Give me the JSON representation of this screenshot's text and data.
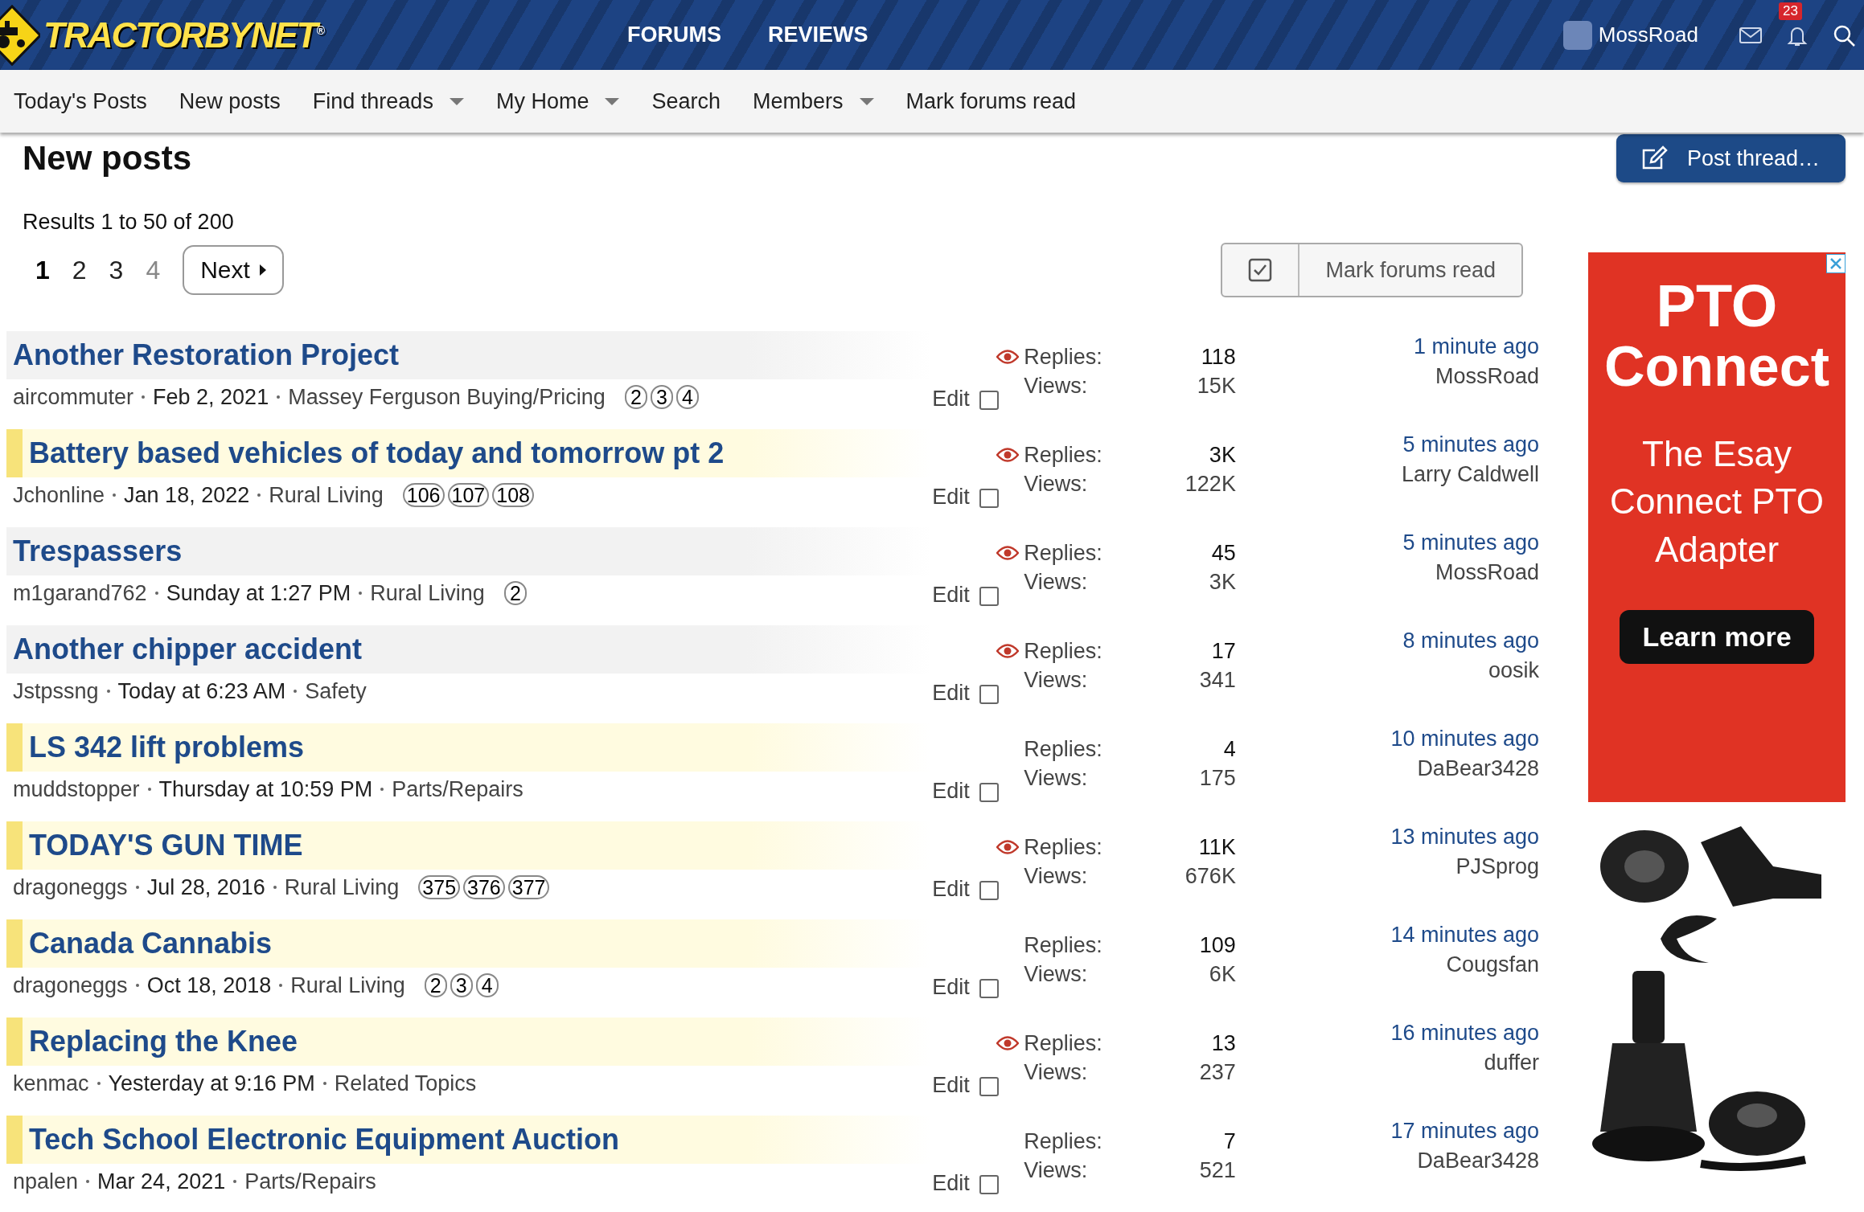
{
  "header": {
    "logo": "TRACTORBYNET",
    "logo_mark": "®",
    "nav": [
      {
        "label": "FORUMS"
      },
      {
        "label": "REVIEWS"
      }
    ],
    "user": "MossRoad",
    "alerts_badge": "23"
  },
  "subnav": [
    {
      "label": "Today's Posts",
      "has_menu": false
    },
    {
      "label": "New posts",
      "has_menu": false
    },
    {
      "label": "Find threads",
      "has_menu": true
    },
    {
      "label": "My Home",
      "has_menu": true
    },
    {
      "label": "Search",
      "has_menu": false
    },
    {
      "label": "Members",
      "has_menu": true
    },
    {
      "label": "Mark forums read",
      "has_menu": false
    }
  ],
  "page_title": "New posts",
  "post_button": "Post thread…",
  "results": "Results 1 to 50 of 200",
  "pagination": [
    {
      "label": "1",
      "selected": true,
      "muted": false
    },
    {
      "label": "2",
      "selected": false,
      "muted": false
    },
    {
      "label": "3",
      "selected": false,
      "muted": false
    },
    {
      "label": "4",
      "selected": false,
      "muted": true
    }
  ],
  "next_button": "Next",
  "mark_read_button": "Mark forums read",
  "threads": [
    {
      "title": "Another Restoration Project",
      "unread": false,
      "author": "aircommuter",
      "date": "Feb 2, 2021",
      "forum": "Massey Ferguson Buying/Pricing",
      "pages": [
        "2",
        "3",
        "4"
      ],
      "watched": true,
      "edit": "Edit",
      "checked": false,
      "replies_label": "Replies:",
      "replies": "118",
      "views_label": "Views:",
      "views": "15K",
      "last_time": "1 minute ago",
      "last_user": "MossRoad"
    },
    {
      "title": "Battery based vehicles of today and tomorrow pt 2",
      "unread": true,
      "author": "Jchonline",
      "date": "Jan 18, 2022",
      "forum": "Rural Living",
      "pages": [
        "106",
        "107",
        "108"
      ],
      "watched": true,
      "edit": "Edit",
      "checked": false,
      "replies_label": "Replies:",
      "replies": "3K",
      "views_label": "Views:",
      "views": "122K",
      "last_time": "5 minutes ago",
      "last_user": "Larry Caldwell"
    },
    {
      "title": "Trespassers",
      "unread": false,
      "author": "m1garand762",
      "date": "Sunday at 1:27 PM",
      "forum": "Rural Living",
      "pages": [
        "2"
      ],
      "watched": true,
      "edit": "Edit",
      "checked": false,
      "replies_label": "Replies:",
      "replies": "45",
      "views_label": "Views:",
      "views": "3K",
      "last_time": "5 minutes ago",
      "last_user": "MossRoad"
    },
    {
      "title": "Another chipper accident",
      "unread": false,
      "author": "Jstpssng",
      "date": "Today at 6:23 AM",
      "forum": "Safety",
      "watched": true,
      "edit": "Edit",
      "checked": false,
      "replies_label": "Replies:",
      "replies": "17",
      "views_label": "Views:",
      "views": "341",
      "last_time": "8 minutes ago",
      "last_user": "oosik"
    },
    {
      "title": "LS 342 lift problems",
      "unread": true,
      "author": "muddstopper",
      "date": "Thursday at 10:59 PM",
      "forum": "Parts/Repairs",
      "watched": false,
      "edit": "Edit",
      "checked": false,
      "replies_label": "Replies:",
      "replies": "4",
      "views_label": "Views:",
      "views": "175",
      "last_time": "10 minutes ago",
      "last_user": "DaBear3428"
    },
    {
      "title": "TODAY'S GUN TIME",
      "unread": true,
      "author": "dragoneggs",
      "date": "Jul 28, 2016",
      "forum": "Rural Living",
      "pages": [
        "375",
        "376",
        "377"
      ],
      "watched": true,
      "edit": "Edit",
      "checked": false,
      "replies_label": "Replies:",
      "replies": "11K",
      "views_label": "Views:",
      "views": "676K",
      "last_time": "13 minutes ago",
      "last_user": "PJSprog"
    },
    {
      "title": "Canada Cannabis",
      "unread": true,
      "author": "dragoneggs",
      "date": "Oct 18, 2018",
      "forum": "Rural Living",
      "pages": [
        "2",
        "3",
        "4"
      ],
      "watched": false,
      "edit": "Edit",
      "checked": false,
      "replies_label": "Replies:",
      "replies": "109",
      "views_label": "Views:",
      "views": "6K",
      "last_time": "14 minutes ago",
      "last_user": "Cougsfan"
    },
    {
      "title": "Replacing the Knee",
      "unread": true,
      "author": "kenmac",
      "date": "Yesterday at 9:16 PM",
      "forum": "Related Topics",
      "watched": true,
      "edit": "Edit",
      "checked": false,
      "replies_label": "Replies:",
      "replies": "13",
      "views_label": "Views:",
      "views": "237",
      "last_time": "16 minutes ago",
      "last_user": "duffer"
    },
    {
      "title": "Tech School Electronic Equipment Auction",
      "unread": true,
      "author": "npalen",
      "date": "Mar 24, 2021",
      "forum": "Parts/Repairs",
      "watched": false,
      "edit": "Edit",
      "checked": false,
      "replies_label": "Replies:",
      "replies": "7",
      "views_label": "Views:",
      "views": "521",
      "last_time": "17 minutes ago",
      "last_user": "DaBear3428"
    }
  ],
  "ad": {
    "headline": "PTO",
    "headline2": "Connect",
    "text": "The Esay Connect PTO Adapter",
    "button": "Learn more"
  }
}
